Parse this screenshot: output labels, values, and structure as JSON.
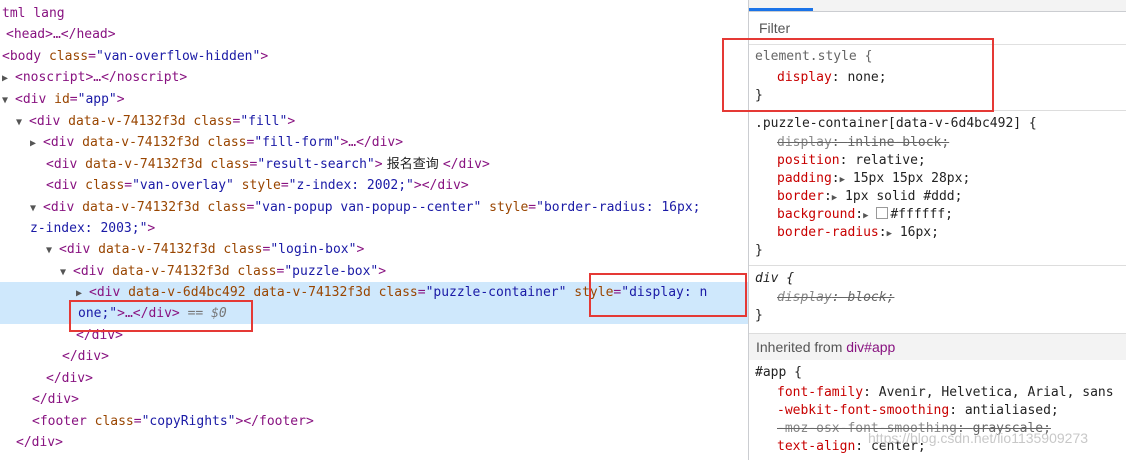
{
  "elements_panel": {
    "lines": [
      {
        "t": "tml lang"
      },
      {
        "t": "<head>…</head>"
      },
      {
        "t": "<body class=\"van-overflow-hidden\">"
      },
      {
        "t": "<noscript>…</noscript>"
      },
      {
        "t": "<div id=\"app\">"
      },
      {
        "t": "<div data-v-74132f3d class=\"fill\">"
      },
      {
        "t": "<div data-v-74132f3d class=\"fill-form\">…</div>"
      },
      {
        "t": "<div data-v-74132f3d class=\"result-search\">",
        "text": " 报名查询 ",
        "close": "</div>"
      },
      {
        "t": "<div class=\"van-overlay\" style=\"z-index: 2002;\"></div>"
      },
      {
        "t": "<div data-v-74132f3d class=\"van-popup van-popup--center\" style=\"border-radius: 16px;"
      },
      {
        "t": "z-index: 2003;\">"
      },
      {
        "t": "<div data-v-74132f3d class=\"login-box\">"
      },
      {
        "t": "<div data-v-74132f3d class=\"puzzle-box\">"
      },
      {
        "t": "<div data-v-6d4bc492 data-v-74132f3d class=\"puzzle-container\" style=\"display: n"
      },
      {
        "t": "one;\">…</div>",
        "marker": " == $0"
      },
      {
        "t": "</div>"
      },
      {
        "t": "</div>"
      },
      {
        "t": "</div>"
      },
      {
        "t": "</div>"
      },
      {
        "t": "<footer class=\"copyRights\"></footer>"
      },
      {
        "t": "</div>"
      }
    ]
  },
  "styles_panel": {
    "filter_placeholder": "Filter",
    "element_style": {
      "selector": "element.style {",
      "prop": "display",
      "value": "none;",
      "close": "}"
    },
    "puzzle_rule": {
      "selector": ".puzzle-container[data-v-6d4bc492] {",
      "props": [
        {
          "name": "display",
          "value": "inline-block;",
          "struck": true
        },
        {
          "name": "position",
          "value": "relative;"
        },
        {
          "name": "padding",
          "value": "15px 15px 28px;"
        },
        {
          "name": "border",
          "value": "1px solid #ddd;"
        },
        {
          "name": "background",
          "value": "#ffffff;"
        },
        {
          "name": "border-radius",
          "value": "16px;"
        }
      ],
      "close": "}"
    },
    "div_rule": {
      "selector": "div {",
      "prop": "display",
      "value": "block;",
      "close": "}"
    },
    "inherited_label": "Inherited from",
    "inherited_ref": "div#app",
    "app_rule": {
      "selector": "#app {",
      "props": [
        {
          "name": "font-family",
          "value": "Avenir, Helvetica, Arial, sans"
        },
        {
          "name": "-webkit-font-smoothing",
          "value": "antialiased;"
        },
        {
          "name": "-moz-osx-font-smoothing",
          "value": "grayscale;",
          "struck": true
        },
        {
          "name": "text-align",
          "value": "center;"
        }
      ]
    }
  },
  "watermark": "https://blog.csdn.net/lio1135909273",
  "colors": {
    "highlight_box": "#e53935",
    "selected_row": "#cfe8fc",
    "tag": "#881280",
    "attr_name": "#994500",
    "attr_value": "#1a1aa6",
    "css_prop": "#c80000"
  }
}
